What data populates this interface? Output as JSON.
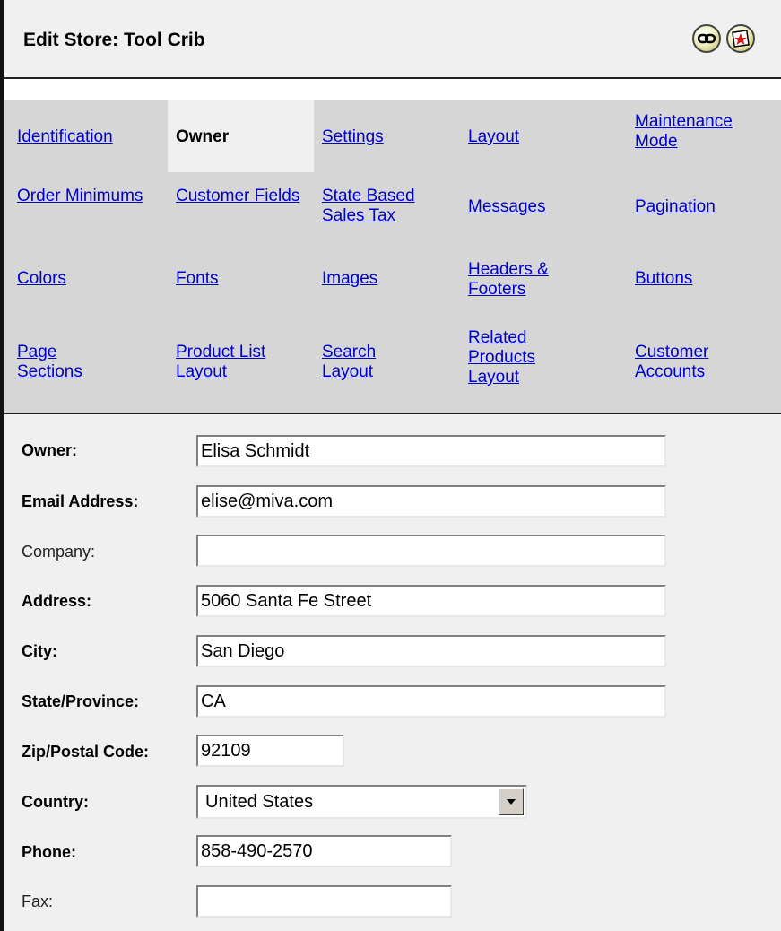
{
  "window": {
    "title": "Edit Store: Tool Crib",
    "icons": [
      "link-icon",
      "help-icon"
    ]
  },
  "tabs": [
    {
      "label": "Identification",
      "active": false
    },
    {
      "label": "Owner",
      "active": true
    },
    {
      "label": "Settings",
      "active": false
    },
    {
      "label": "Layout",
      "active": false
    },
    {
      "label": "Maintenance Mode",
      "active": false
    },
    {
      "label": "Order Minimums",
      "active": false
    },
    {
      "label": "Customer Fields",
      "active": false
    },
    {
      "label": "State Based Sales Tax",
      "active": false
    },
    {
      "label": "Messages",
      "active": false
    },
    {
      "label": "Pagination",
      "active": false
    },
    {
      "label": "Colors",
      "active": false
    },
    {
      "label": "Fonts",
      "active": false
    },
    {
      "label": "Images",
      "active": false
    },
    {
      "label": "Headers & Footers",
      "active": false
    },
    {
      "label": "Buttons",
      "active": false
    },
    {
      "label": "Page Sections",
      "active": false
    },
    {
      "label": "Product List Layout",
      "active": false
    },
    {
      "label": "Search Layout",
      "active": false
    },
    {
      "label": "Related Products Layout",
      "active": false
    },
    {
      "label": "Customer Accounts",
      "active": false
    }
  ],
  "form": {
    "owner": {
      "label": "Owner:",
      "value": "Elisa Schmidt"
    },
    "email": {
      "label": "Email Address:",
      "value": "elise@miva.com"
    },
    "company": {
      "label": "Company:",
      "value": ""
    },
    "address": {
      "label": "Address:",
      "value": "5060 Santa Fe Street"
    },
    "city": {
      "label": "City:",
      "value": "San Diego"
    },
    "state": {
      "label": "State/Province:",
      "value": "CA"
    },
    "zip": {
      "label": "Zip/Postal Code:",
      "value": "92109"
    },
    "country": {
      "label": "Country:",
      "value": "United States"
    },
    "phone": {
      "label": "Phone:",
      "value": "858-490-2570"
    },
    "fax": {
      "label": "Fax:",
      "value": ""
    }
  },
  "colors": {
    "link": "#0000cc",
    "tab_bg": "#d6d6d6",
    "panel_bg": "#f0f0f0"
  }
}
